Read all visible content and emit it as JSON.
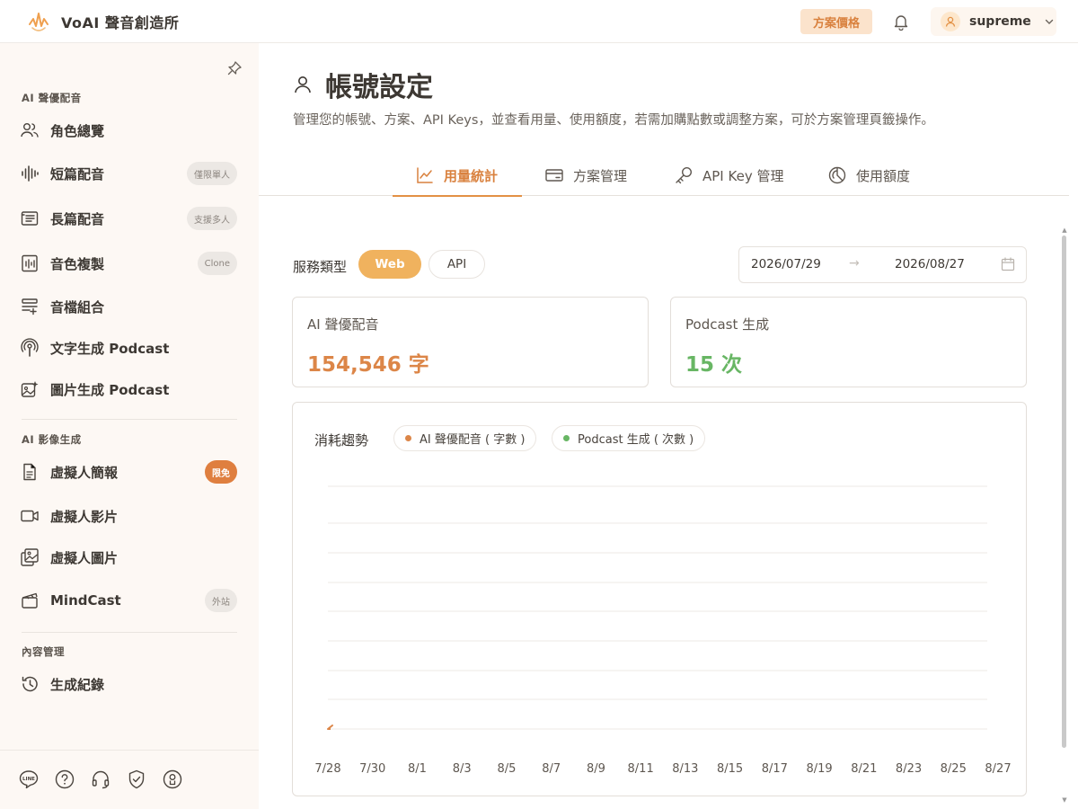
{
  "header": {
    "brand": "VoAI 聲音創造所",
    "pricing_label": "方案價格",
    "username": "supreme"
  },
  "sidebar": {
    "sections": [
      {
        "title": "AI 聲優配音",
        "items": [
          {
            "label": "角色總覽",
            "icon": "users-icon",
            "badge": ""
          },
          {
            "label": "短篇配音",
            "icon": "waveform-icon",
            "badge": "僅限單人"
          },
          {
            "label": "長篇配音",
            "icon": "document-list-icon",
            "badge": "支援多人"
          },
          {
            "label": "音色複製",
            "icon": "voice-clone-icon",
            "badge": "Clone"
          },
          {
            "label": "音檔組合",
            "icon": "stack-add-icon",
            "badge": ""
          },
          {
            "label": "文字生成 Podcast",
            "icon": "podcast-icon",
            "badge": ""
          },
          {
            "label": "圖片生成 Podcast",
            "icon": "image-sparkle-icon",
            "badge": ""
          }
        ]
      },
      {
        "title": "AI 影像生成",
        "items": [
          {
            "label": "虛擬人簡報",
            "icon": "file-text-icon",
            "badge": "限免"
          },
          {
            "label": "虛擬人影片",
            "icon": "video-icon",
            "badge": ""
          },
          {
            "label": "虛擬人圖片",
            "icon": "image-icon",
            "badge": ""
          },
          {
            "label": "MindCast",
            "icon": "clapperboard-icon",
            "badge": "外站"
          }
        ]
      },
      {
        "title": "內容管理",
        "items": [
          {
            "label": "生成紀錄",
            "icon": "history-icon",
            "badge": ""
          }
        ]
      }
    ],
    "footer_icons": [
      "line-icon",
      "help-icon",
      "headset-icon",
      "shield-check-icon",
      "privacy-icon"
    ]
  },
  "page": {
    "title": "帳號設定",
    "description": "管理您的帳號、方案、API Keys，並查看用量、使用額度，若需加購點數或調整方案，可於方案管理頁籤操作。"
  },
  "tabs": [
    {
      "label": "用量統計",
      "icon": "line-chart-icon",
      "active": true
    },
    {
      "label": "方案管理",
      "icon": "credit-card-icon",
      "active": false
    },
    {
      "label": "API Key 管理",
      "icon": "key-icon",
      "active": false
    },
    {
      "label": "使用額度",
      "icon": "pie-chart-icon",
      "active": false
    }
  ],
  "filters": {
    "service_label": "服務類型",
    "service_options": [
      "Web",
      "API"
    ],
    "selected_service": "Web",
    "date_start": "2026/07/29",
    "date_end": "2026/08/27"
  },
  "stats": [
    {
      "label": "AI 聲優配音",
      "value": "154,546 字"
    },
    {
      "label": "Podcast 生成",
      "value": "15 次"
    }
  ],
  "colors": {
    "accent": "#d9813e",
    "voice_series": "#dc8648",
    "podcast_series": "#68b664",
    "pill_active": "#f0b25e"
  },
  "chart_data": {
    "type": "line",
    "title": "消耗趨勢",
    "x": [
      "7/28",
      "7/30",
      "8/1",
      "8/3",
      "8/5",
      "8/7",
      "8/9",
      "8/11",
      "8/13",
      "8/15",
      "8/17",
      "8/19",
      "8/21",
      "8/23",
      "8/25",
      "8/27"
    ],
    "series": [
      {
        "name": "AI 聲優配音 ( 字數 )",
        "color": "#dc8648",
        "values": [
          0,
          0
        ]
      },
      {
        "name": "Podcast 生成 ( 次數 )",
        "color": "#68b664",
        "values": []
      }
    ],
    "grid": true,
    "legend": "top-left"
  }
}
